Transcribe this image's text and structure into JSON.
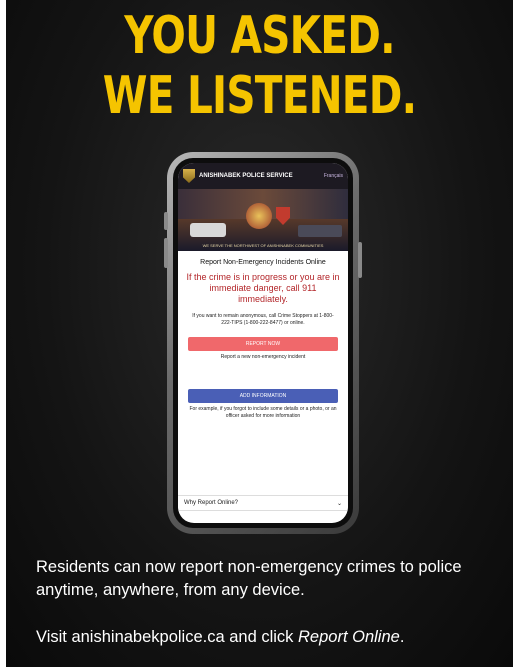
{
  "headline": {
    "line1": "YOU ASKED.",
    "line2": "WE LISTENED."
  },
  "phone": {
    "agency": "ANISHINABEK POLICE SERVICE",
    "language": "Français",
    "banner_tagline": "WE SERVE THE NORTHWEST OF ANISHINABEK COMMUNITIES",
    "page_title": "Report Non-Emergency Incidents Online",
    "warning": "If the crime is in progress or you are in immediate danger, call 911 immediately.",
    "anon_note": "If you want to remain anonymous, call Crime Stoppers at 1-800-222-TIPS (1-800-222-8477) or online.",
    "report_button": "REPORT NOW",
    "report_caption": "Report a new non-emergency incident",
    "add_button": "ADD INFORMATION",
    "add_caption": "For example, if you forgot to include some details or a photo, or an officer asked for more information",
    "faq_label": "Why Report Online?"
  },
  "body_text": "Residents can now report non-emergency crimes to police anytime, anywhere, from any device.",
  "cta": {
    "prefix": "Visit anishinabekpolice.ca and click ",
    "emphasis": "Report Online",
    "suffix": "."
  },
  "colors": {
    "headline": "#f5c400",
    "warning": "#b3262a",
    "report_button": "#f0686b",
    "add_button": "#4a5fb6"
  }
}
